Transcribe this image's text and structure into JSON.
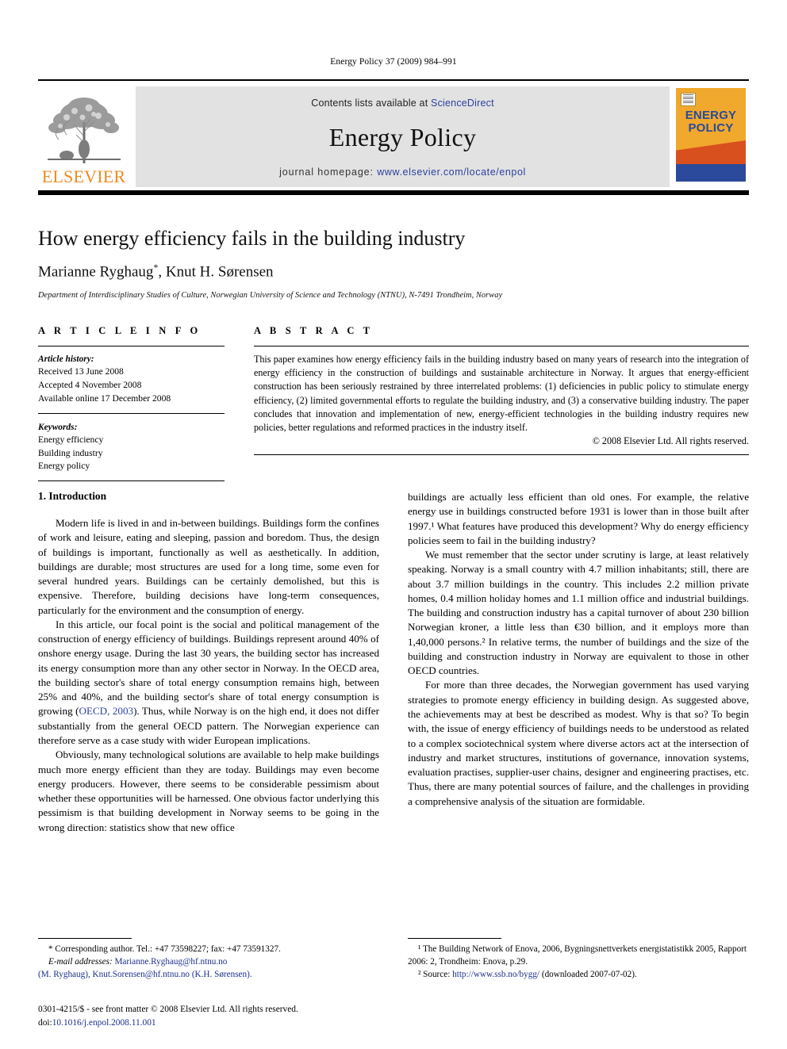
{
  "running_head": "Energy Policy 37 (2009) 984–991",
  "masthead": {
    "elsevier_wordmark": "ELSEVIER",
    "tree_logo_name": "elsevier-tree-logo",
    "contents_prefix": "Contents lists available at ",
    "contents_link": "ScienceDirect",
    "journal_name": "Energy Policy",
    "homepage_prefix": "journal homepage: ",
    "homepage_link": "www.elsevier.com/locate/enpol",
    "cover_title_line1": "ENERGY",
    "cover_title_line2": "POLICY"
  },
  "colors": {
    "elsevier_orange": "#ee8a22",
    "link_blue": "#2b3f9e",
    "contents_box_grey": "#e2e2e2",
    "cover_amber": "#f0a92c",
    "cover_red": "#d9501f",
    "cover_blue": "#2b4a9b"
  },
  "title": "How energy efficiency fails in the building industry",
  "authors": "Marianne Ryghaug",
  "authors_tail": ", Knut H. Sørensen",
  "corresponding_marker": "*",
  "affiliation": "Department of Interdisciplinary Studies of Culture, Norwegian University of Science and Technology (NTNU), N-7491 Trondheim, Norway",
  "article_info": {
    "heading": "A R T I C L E   I N F O",
    "history_label": "Article history:",
    "history": [
      "Received 13 June 2008",
      "Accepted 4 November 2008",
      "Available online 17 December 2008"
    ],
    "keywords_label": "Keywords:",
    "keywords": [
      "Energy efficiency",
      "Building industry",
      "Energy policy"
    ]
  },
  "abstract": {
    "heading": "A B S T R A C T",
    "text": "This paper examines how energy efficiency fails in the building industry based on many years of research into the integration of energy efficiency in the construction of buildings and sustainable architecture in Norway. It argues that energy-efficient construction has been seriously restrained by three interrelated problems: (1) deficiencies in public policy to stimulate energy efficiency, (2) limited governmental efforts to regulate the building industry, and (3) a conservative building industry. The paper concludes that innovation and implementation of new, energy-efficient technologies in the building industry requires new policies, better regulations and reformed practices in the industry itself.",
    "copyright": "© 2008 Elsevier Ltd. All rights reserved."
  },
  "body": {
    "section_title": "1. Introduction",
    "left_paragraphs": [
      "Modern life is lived in and in-between buildings. Buildings form the confines of work and leisure, eating and sleeping, passion and boredom. Thus, the design of buildings is important, functionally as well as aesthetically. In addition, buildings are durable; most structures are used for a long time, some even for several hundred years. Buildings can be certainly demolished, but this is expensive. Therefore, building decisions have long-term consequences, particularly for the environment and the consumption of energy.",
      "In this article, our focal point is the social and political management of the construction of energy efficiency of buildings. Buildings represent around 40% of onshore energy usage. During the last 30 years, the building sector has increased its energy consumption more than any other sector in Norway. In the OECD area, the building sector's share of total energy consumption remains high, between 25% and 40%, and the building sector's share of total energy consumption is growing (OECD, 2003). Thus, while Norway is on the high end, it does not differ substantially from the general OECD pattern. The Norwegian experience can therefore serve as a case study with wider European implications.",
      "Obviously, many technological solutions are available to help make buildings much more energy efficient than they are today. Buildings may even become energy producers. However, there seems to be considerable pessimism about whether these opportunities will be harnessed. One obvious factor underlying this pessimism is that building development in Norway seems to be going in the wrong direction: statistics show that new office"
    ],
    "left_inline_link": "OECD, 2003",
    "right_paragraphs": [
      "buildings are actually less efficient than old ones. For example, the relative energy use in buildings constructed before 1931 is lower than in those built after 1997.¹ What features have produced this development? Why do energy efficiency policies seem to fail in the building industry?",
      "We must remember that the sector under scrutiny is large, at least relatively speaking. Norway is a small country with 4.7 million inhabitants; still, there are about 3.7 million buildings in the country. This includes 2.2 million private homes, 0.4 million holiday homes and 1.1 million office and industrial buildings. The building and construction industry has a capital turnover of about 230 billion Norwegian kroner, a little less than €30 billion, and it employs more than 1,40,000 persons.² In relative terms, the number of buildings and the size of the building and construction industry in Norway are equivalent to those in other OECD countries.",
      "For more than three decades, the Norwegian government has used varying strategies to promote energy efficiency in building design. As suggested above, the achievements may at best be described as modest. Why is that so? To begin with, the issue of energy efficiency of buildings needs to be understood as related to a complex sociotechnical system where diverse actors act at the intersection of industry and market structures, institutions of governance, innovation systems, evaluation practises, supplier-user chains, designer and engineering practises, etc. Thus, there are many potential sources of failure, and the challenges in providing a comprehensive analysis of the situation are formidable."
    ]
  },
  "footnotes": {
    "left": {
      "corresponding": "* Corresponding author. Tel.: +47 73598227; fax: +47 73591327.",
      "email_label": "E-mail addresses:",
      "email_1": "Marianne.Ryghaug@hf.ntnu.no",
      "email_1_owner": "(M. Ryghaug),",
      "email_2": "Knut.Sorensen@hf.ntnu.no",
      "email_2_owner": "(K.H. Sørensen)."
    },
    "right": {
      "note_1": "¹ The Building Network of Enova, 2006, Bygningsnettverkets energistatistikk 2005, Rapport 2006: 2, Trondheim: Enova, p.29.",
      "note_2_prefix": "² Source: ",
      "note_2_link": "http://www.ssb.no/bygg/",
      "note_2_suffix": " (downloaded 2007-07-02)."
    }
  },
  "imprint": {
    "line1": "0301-4215/$ - see front matter © 2008 Elsevier Ltd. All rights reserved.",
    "doi_prefix": "doi:",
    "doi": "10.1016/j.enpol.2008.11.001"
  }
}
